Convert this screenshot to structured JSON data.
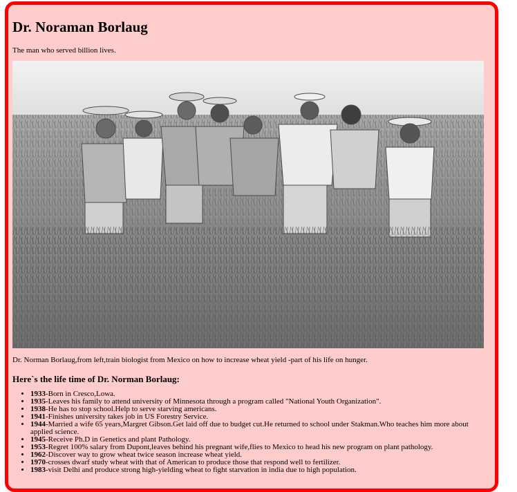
{
  "page": {
    "title": "Dr. Noraman Borlaug",
    "subtitle": "The man who served billion lives.",
    "image_alt": "Dr. Norman Borlaug with group in a wheat field",
    "caption": "Dr. Norman Borlaug,from left,train biologist from Mexico on how to increase wheat yield -part of his life on hunger.",
    "section_heading": "Here`s the life time of Dr. Norman Borlaug:"
  },
  "timeline": [
    {
      "year": "1933",
      "text": "-Born in Cresco,Lowa."
    },
    {
      "year": "1935",
      "text": "-Leaves his family to attend university of Minnesota through a program called \"National Youth Organization\"."
    },
    {
      "year": "1938",
      "text": "-He has to stop school.Help to serve starving americans."
    },
    {
      "year": "1941",
      "text": "-Finishes university takes job in US Forestry Service."
    },
    {
      "year": "1944",
      "text": "-Married a wife 65 years,Margret Gibson.Get laid off due to budget cut.He returned to school under Stakman.Who teaches him more about applied science."
    },
    {
      "year": "1945",
      "text": "-Receive Ph.D in Genetics and plant Pathology."
    },
    {
      "year": "1953",
      "text": "-Regret 100% salary from Dupont,leaves behind his pregnant wife,flies to Mexico to head his new program on plant pathology."
    },
    {
      "year": "1962",
      "text": "-Discover way to grow wheat twice season increase wheat yield."
    },
    {
      "year": "1970",
      "text": "-crosses dwarf study wheat with that of American to produce those that respond well to fertilizer."
    },
    {
      "year": "1983",
      "text": "-visit Delhi and produce strong high-yielding wheat to fight starvation in india due to high population."
    }
  ],
  "colors": {
    "background": "#ffcccc",
    "border": "#ff0000"
  }
}
